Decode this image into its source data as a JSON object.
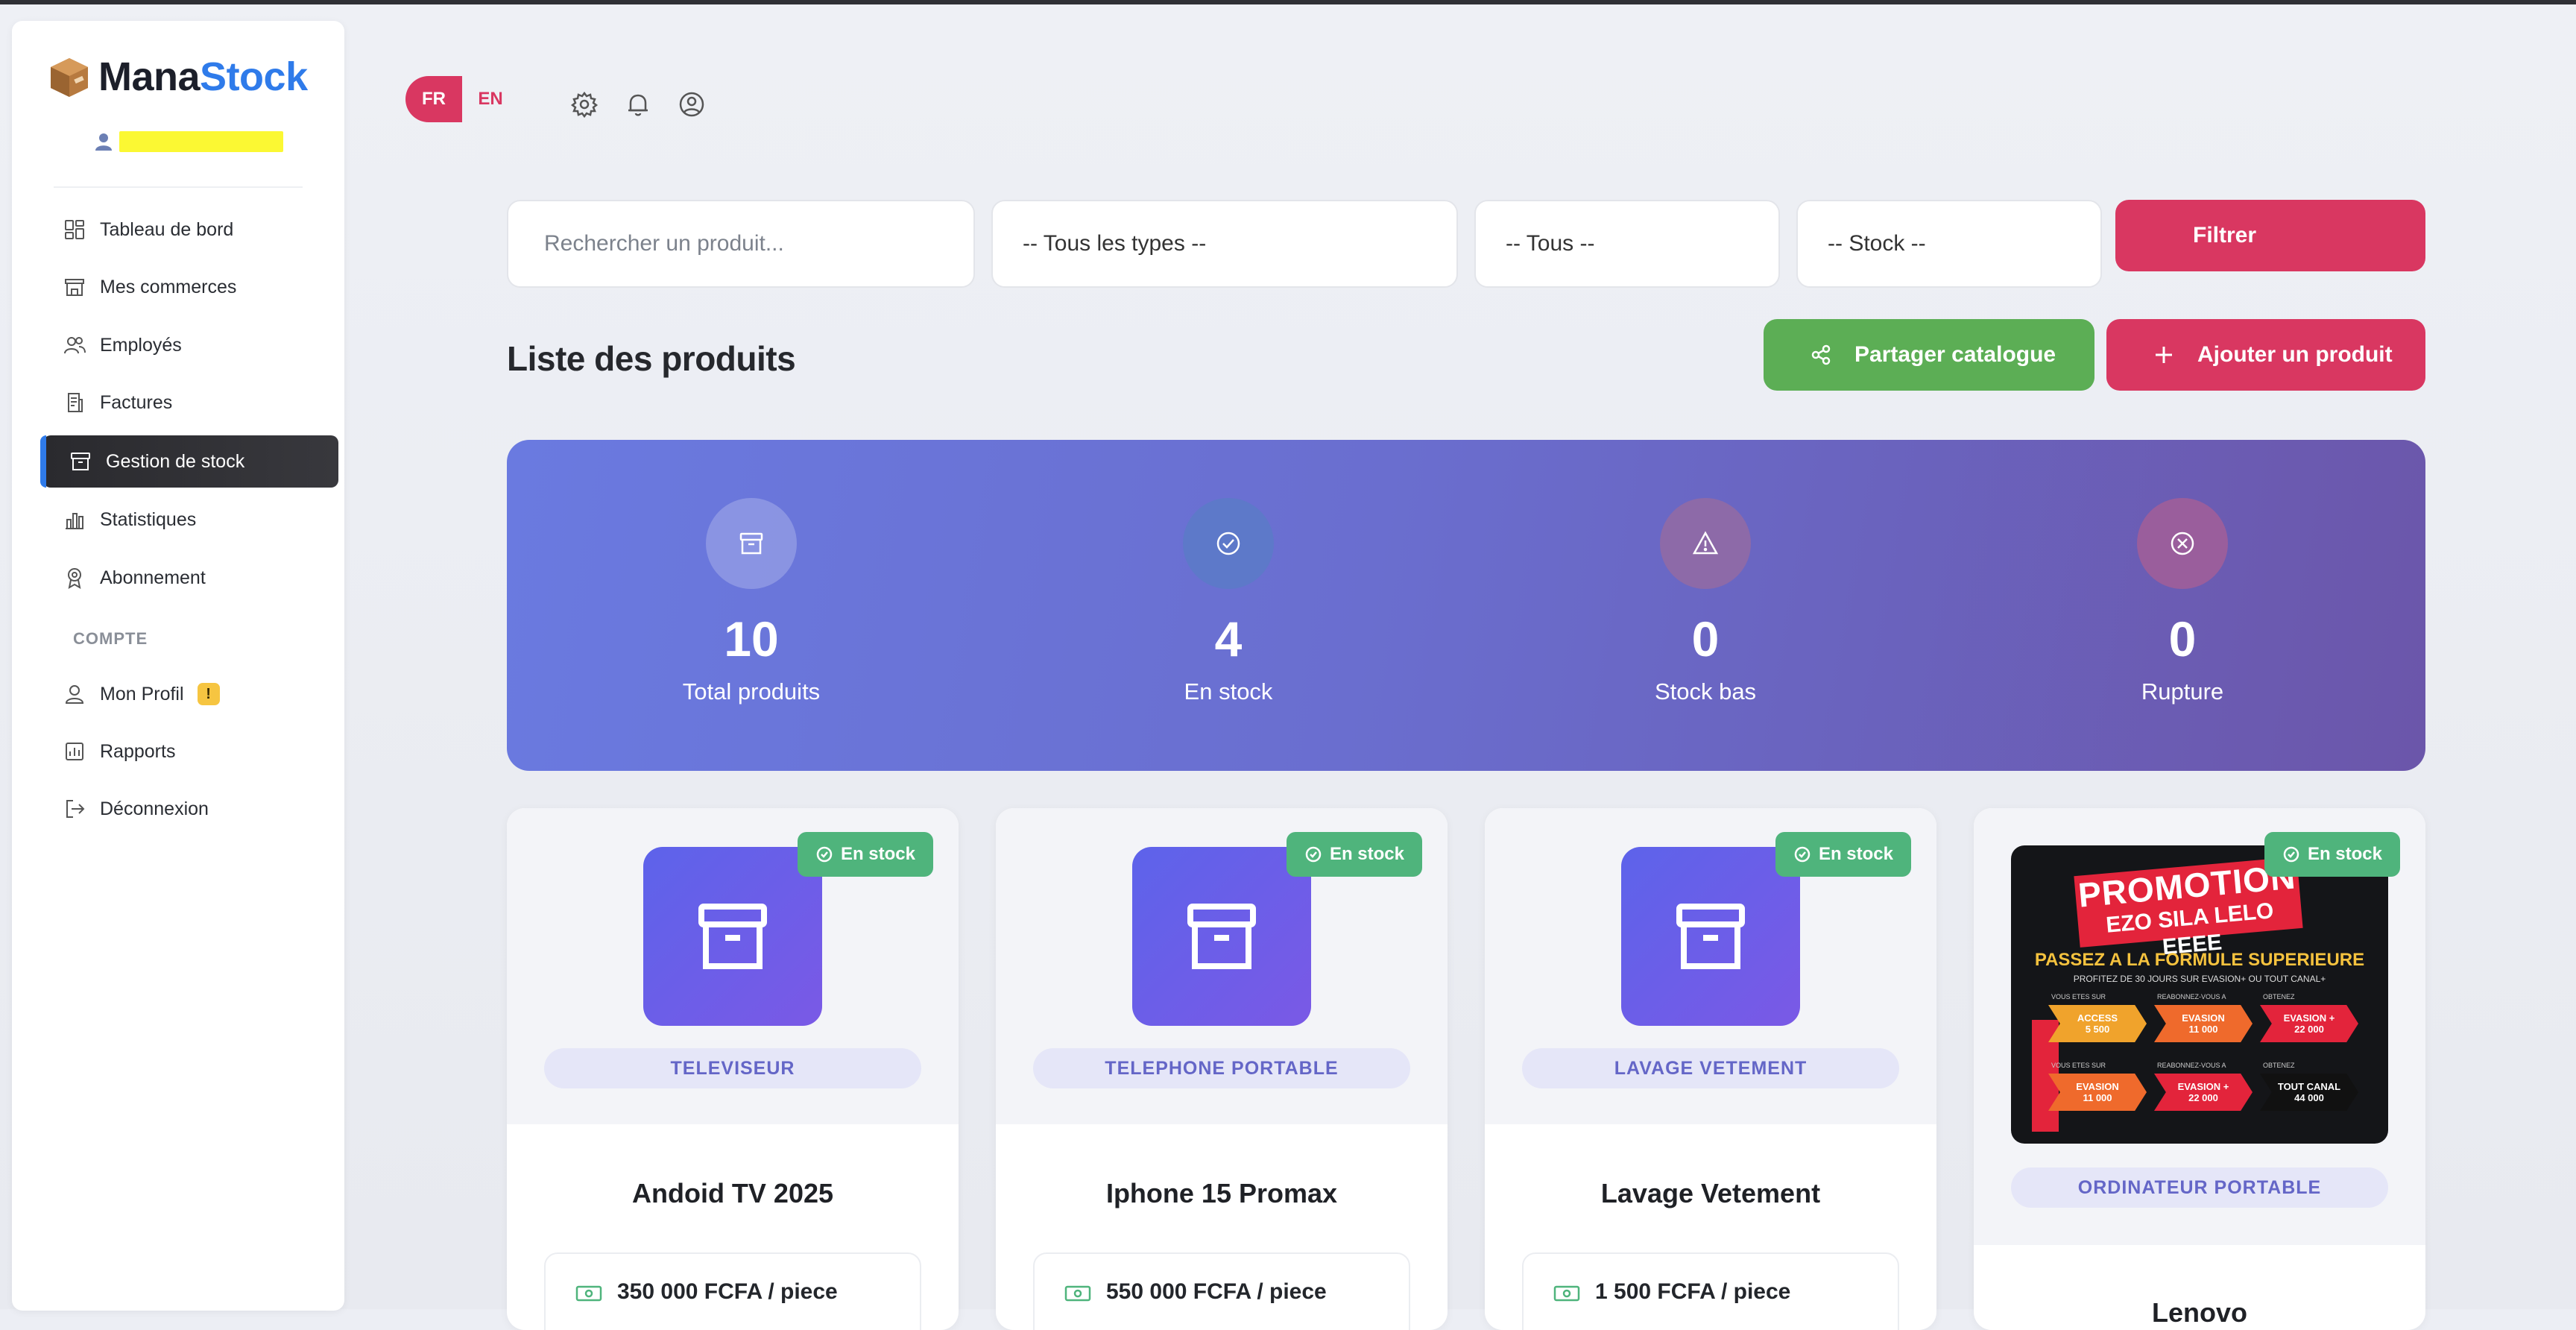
{
  "brand": {
    "name_part1": "Mana",
    "name_part2": "Stock"
  },
  "sidebar": {
    "items": [
      {
        "label": "Tableau de bord",
        "icon": "dashboard-icon"
      },
      {
        "label": "Mes commerces",
        "icon": "store-icon"
      },
      {
        "label": "Employés",
        "icon": "users-icon"
      },
      {
        "label": "Factures",
        "icon": "invoice-icon"
      },
      {
        "label": "Gestion de stock",
        "icon": "archive-icon",
        "active": true
      },
      {
        "label": "Statistiques",
        "icon": "bar-chart-icon"
      },
      {
        "label": "Abonnement",
        "icon": "award-icon"
      }
    ],
    "section_label": "COMPTE",
    "account_items": [
      {
        "label": "Mon Profil",
        "icon": "person-icon",
        "badge": "!"
      },
      {
        "label": "Rapports",
        "icon": "report-icon"
      },
      {
        "label": "Déconnexion",
        "icon": "logout-icon"
      }
    ]
  },
  "topbar": {
    "lang_fr": "FR",
    "lang_en": "EN",
    "icons": [
      "gear-icon",
      "bell-icon",
      "user-circle-icon"
    ]
  },
  "filters": {
    "search_placeholder": "Rechercher un produit...",
    "type_select": "-- Tous les types --",
    "all_select": "-- Tous --",
    "stock_select": "-- Stock --",
    "filter_button": "Filtrer"
  },
  "page": {
    "title": "Liste des produits",
    "share_button": "Partager catalogue",
    "add_button": "Ajouter un produit"
  },
  "stats": [
    {
      "value": "10",
      "label": "Total produits",
      "icon": "archive-icon",
      "circle_color": "rgba(255,255,255,0.22)"
    },
    {
      "value": "4",
      "label": "En stock",
      "icon": "check-circle-icon",
      "circle_color": "#5d79c9"
    },
    {
      "value": "0",
      "label": "Stock bas",
      "icon": "warning-icon",
      "circle_color": "#8d6aa8"
    },
    {
      "value": "0",
      "label": "Rupture",
      "icon": "x-circle-icon",
      "circle_color": "#9a5e9c"
    }
  ],
  "products": [
    {
      "name": "Andoid TV 2025",
      "category": "TELEVISEUR",
      "status": "En stock",
      "price": "350 000 FCFA / piece"
    },
    {
      "name": "Iphone 15 Promax",
      "category": "TELEPHONE PORTABLE",
      "status": "En stock",
      "price": "550 000 FCFA / piece"
    },
    {
      "name": "Lavage Vetement",
      "category": "LAVAGE VETEMENT",
      "status": "En stock",
      "price": "1 500 FCFA / piece"
    },
    {
      "name": "Lenovo",
      "category": "ORDINATEUR PORTABLE",
      "status": "En stock",
      "price": ""
    }
  ],
  "promo": {
    "line1": "PROMOTION",
    "line2": "EZO SILA LELO EEEE",
    "headline": "PASSEZ A LA FORMULE SUPERIEURE",
    "subline": "PROFITEZ DE 30 JOURS SUR EVASION+ OU TOUT CANAL+",
    "row_caption1": "VOUS ETES SUR",
    "row_caption2": "REABONNEZ-VOUS A",
    "row_caption3": "OBTENEZ",
    "chips": [
      {
        "title": "ACCESS",
        "price": "5 500",
        "color": "#f0a32c"
      },
      {
        "title": "EVASION",
        "price": "11 000",
        "color": "#ef6a2c"
      },
      {
        "title": "EVASION +",
        "price": "22 000",
        "color": "#e3243b"
      },
      {
        "title": "EVASION",
        "price": "11 000",
        "color": "#ef6a2c"
      },
      {
        "title": "EVASION +",
        "price": "22 000",
        "color": "#e3243b"
      },
      {
        "title": "TOUT CANAL",
        "price": "44 000",
        "color": "#111111"
      }
    ]
  },
  "colors": {
    "accent": "#d93761",
    "brand_blue": "#2f7bea",
    "success": "#4fb47c",
    "share": "#5cae55"
  }
}
